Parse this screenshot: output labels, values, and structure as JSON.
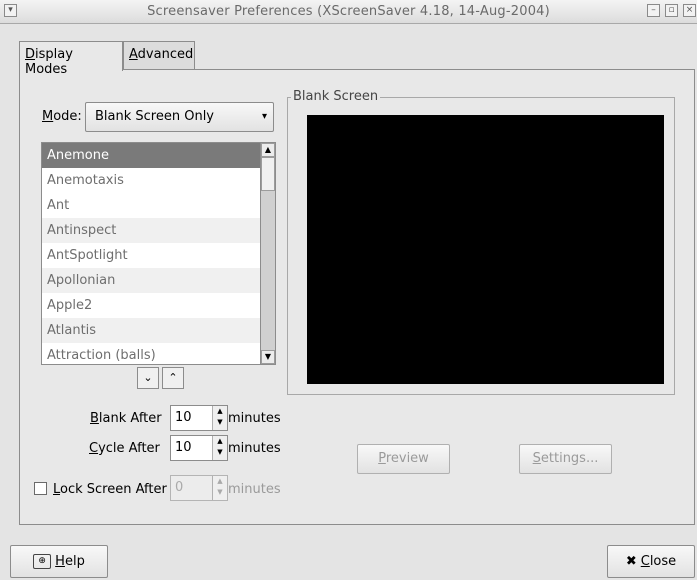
{
  "window": {
    "title": "Screensaver Preferences  (XScreenSaver 4.18, 14-Aug-2004)"
  },
  "tabs": [
    {
      "label": "Display Modes",
      "accel": "D",
      "rest": "isplay Modes"
    },
    {
      "label": "Advanced",
      "accel": "A",
      "rest": "dvanced"
    }
  ],
  "mode": {
    "label_accel": "M",
    "label_rest": "ode:",
    "value": "Blank Screen Only"
  },
  "list": {
    "items": [
      "Anemone",
      "Anemotaxis",
      "Ant",
      "Antinspect",
      "AntSpotlight",
      "Apollonian",
      "Apple2",
      "Atlantis",
      "Attraction (balls)"
    ],
    "selected": "Anemone"
  },
  "preview_frame": {
    "label": "Blank Screen"
  },
  "blank_after": {
    "label_accel": "B",
    "label_rest": "lank After",
    "value": "10",
    "unit": "minutes"
  },
  "cycle_after": {
    "label_accel": "C",
    "label_rest": "ycle After",
    "value": "10",
    "unit": "minutes"
  },
  "lock_screen": {
    "label_accel": "L",
    "label_rest": "ock Screen After",
    "value": "0",
    "unit": "minutes",
    "checked": false
  },
  "buttons": {
    "preview": {
      "accel": "P",
      "rest": "review"
    },
    "settings": {
      "accel": "S",
      "rest": "ettings..."
    },
    "help": {
      "accel": "H",
      "rest": "elp"
    },
    "close": {
      "accel": "C",
      "rest": "lose"
    }
  },
  "icons": {
    "window_menu": "chevron-down-icon",
    "minimize": "minimize-icon",
    "maximize": "maximize-icon",
    "close": "close-icon",
    "help": "help-icon",
    "close_btn": "x-icon"
  }
}
